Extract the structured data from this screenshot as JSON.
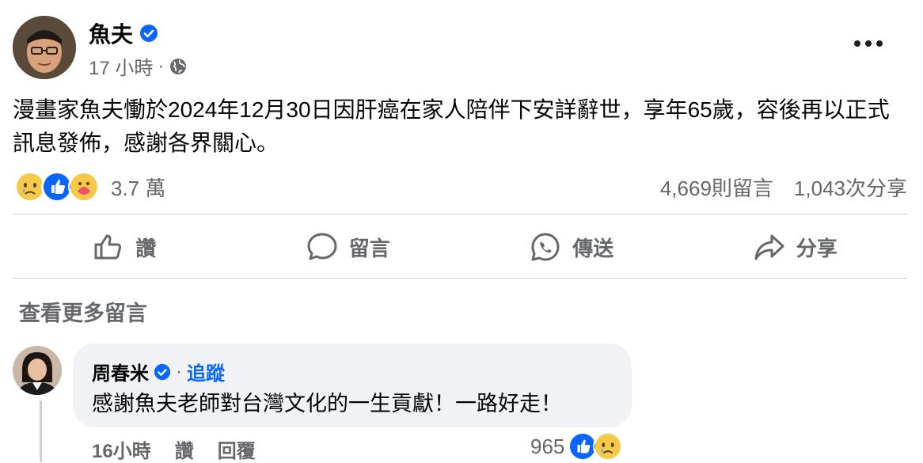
{
  "post": {
    "author": "魚夫",
    "time": "17 小時",
    "meta_dot": "·",
    "text": "漫畫家魚夫慟於2024年12月30日因肝癌在家人陪伴下安詳辭世，享年65歲，容後再以正式訊息發佈，感謝各界關心。",
    "reactions_count": "3.7 萬",
    "comments_count": "4,669則留言",
    "shares_count": "1,043次分享",
    "reaction_icons": [
      "sad-icon",
      "like-icon",
      "care-icon"
    ]
  },
  "actions": {
    "like": "讚",
    "comment": "留言",
    "send": "傳送",
    "share": "分享"
  },
  "view_more_comments": "查看更多留言",
  "comment": {
    "author": "周春米",
    "dot": "·",
    "follow": "追蹤",
    "text": "感謝魚夫老師對台灣文化的一生貢獻！一路好走！",
    "time": "16小時",
    "like": "讚",
    "reply": "回覆",
    "reactions_count": "965"
  },
  "colors": {
    "brand_blue": "#0866ff",
    "secondary_text": "#65676b",
    "bubble_bg": "#f0f2f5"
  }
}
